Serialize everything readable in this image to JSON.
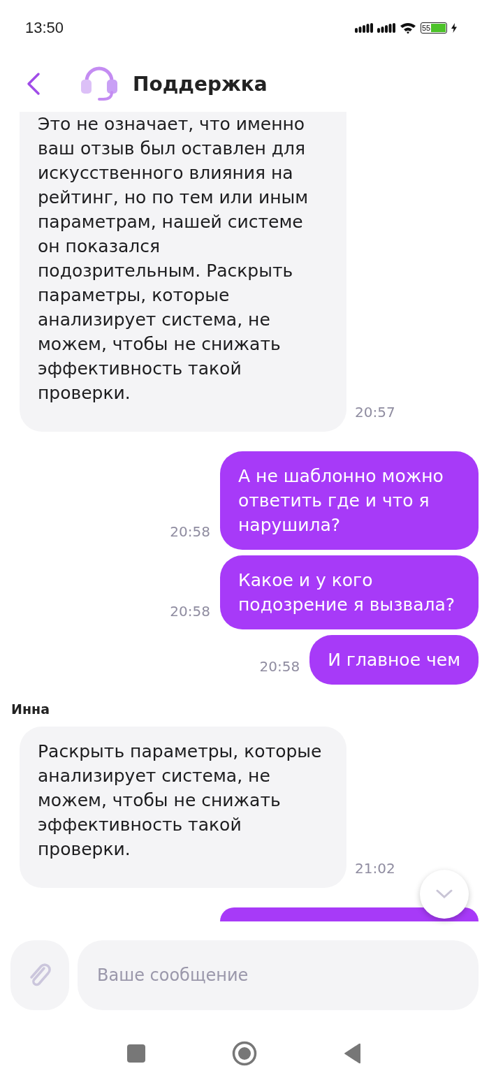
{
  "status_bar": {
    "time": "13:50",
    "battery": "55",
    "charging": true
  },
  "header": {
    "title": "Поддержка"
  },
  "messages": [
    {
      "kind": "incoming",
      "text": "Это не означает, что именно ваш отзыв был оставлен для искусственного влияния на рейтинг, но по тем или иным параметрам, нашей системе он показался подозрительным. Раскрыть параметры, которые анализирует система, не можем, чтобы не снижать эффективность такой проверки.",
      "time": "20:57"
    },
    {
      "kind": "outgoing",
      "text": "А не шаблонно можно ответить где и что я нарушила?",
      "time": "20:58"
    },
    {
      "kind": "outgoing",
      "text": "Какое и у кого подозрение я вызвала?",
      "time": "20:58"
    },
    {
      "kind": "outgoing",
      "text": "И главное чем",
      "time": "20:58"
    },
    {
      "kind": "incoming",
      "sender": "Инна",
      "text": "Раскрыть параметры, которые анализирует система, не можем, чтобы не снижать эффективность такой проверки.",
      "time": "21:02"
    },
    {
      "kind": "outgoing"
    }
  ],
  "composer": {
    "placeholder": "Ваше сообщение"
  }
}
